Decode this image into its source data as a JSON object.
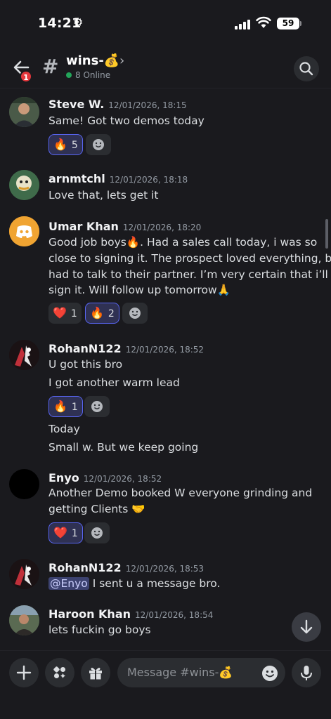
{
  "status": {
    "time": "14:21",
    "battery": "59"
  },
  "header": {
    "back_badge": "1",
    "channel_name": "wins-💰",
    "online": "8 Online"
  },
  "messages": [
    {
      "user": "Steve W.",
      "time": "12/01/2026, 18:15",
      "lines": [
        "Same! Got two demos today"
      ],
      "reactions": [
        {
          "emoji": "🔥",
          "count": "5",
          "reacted": true
        }
      ]
    },
    {
      "user": "arnmtchl",
      "time": "12/01/2026, 18:18",
      "lines": [
        "Love that, lets get it"
      ],
      "reactions": []
    },
    {
      "user": "Umar Khan",
      "time": "12/01/2026, 18:20",
      "lines": [
        "Good job boys🔥. Had a sales call today, i was so",
        "close to signing it. The prospect loved everything, but",
        "had to talk to their partner. I’m very certain that i’ll",
        "sign it. Will follow up tomorrow🙏"
      ],
      "reactions": [
        {
          "emoji": "❤️",
          "count": "1",
          "reacted": false
        },
        {
          "emoji": "🔥",
          "count": "2",
          "reacted": true
        }
      ]
    },
    {
      "user": "RohanN122",
      "time": "12/01/2026, 18:52",
      "lines": [
        "U got this bro",
        "I got another warm lead"
      ],
      "reactions": [
        {
          "emoji": "🔥",
          "count": "1",
          "reacted": true
        }
      ],
      "after_lines": [
        "Today",
        "Small w. But we keep going"
      ]
    },
    {
      "user": "Enyo",
      "time": "12/01/2026, 18:52",
      "lines": [
        "Another Demo booked W everyone grinding and",
        "getting Clients 🤝"
      ],
      "reactions": [
        {
          "emoji": "❤️",
          "count": "1",
          "reacted": true
        }
      ]
    },
    {
      "user": "RohanN122",
      "time": "12/01/2026, 18:53",
      "mention": "@Enyo",
      "lines": [
        " I sent u a message bro."
      ],
      "reactions": []
    },
    {
      "user": "Haroon Khan",
      "time": "12/01/2026, 18:54",
      "lines": [
        "lets fuckin go boys"
      ],
      "reactions": []
    }
  ],
  "composer": {
    "placeholder": "Message #wins-💰"
  },
  "colors": {
    "accent": "#5865f2",
    "online": "#23a55a",
    "badge": "#e3373c",
    "background": "#1a1a1e"
  }
}
